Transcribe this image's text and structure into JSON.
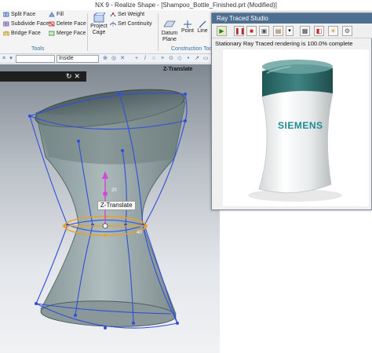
{
  "window": {
    "title": "NX 9 - Realize Shape - [Shampoo_Bottle_Finished.prt (Modified)]"
  },
  "ribbon": {
    "tools_group": {
      "items": [
        {
          "label": "Split Face",
          "icon": "split-face-icon"
        },
        {
          "label": "Fill",
          "icon": "fill-icon"
        },
        {
          "label": "Subdivide Face",
          "icon": "subdivide-face-icon"
        },
        {
          "label": "Delete Face",
          "icon": "delete-face-icon"
        },
        {
          "label": "Bridge Face",
          "icon": "bridge-face-icon"
        },
        {
          "label": "Merge Face",
          "icon": "merge-face-icon"
        }
      ],
      "label": "Tools"
    },
    "project_cage": {
      "label": "Project Cage",
      "icon": "project-cage-icon"
    },
    "set_weight": {
      "label": "Set Weight",
      "icon": "set-weight-icon"
    },
    "set_continuity": {
      "label": "Set Continuity",
      "icon": "set-continuity-icon"
    },
    "construction": {
      "label": "Construction Too",
      "datum_plane": "Datum Plane",
      "point": "Point",
      "line": "Line"
    }
  },
  "selection_bar": {
    "scope_value": "Inside"
  },
  "graphics": {
    "header": "Z-Translate",
    "handle_label": "Z-Translate",
    "handle_tick_top": "20",
    "handle_tick_right": "40"
  },
  "ray_traced_studio": {
    "title": "Ray Traced Studio",
    "status": "Stationary Ray Traced rendering is 100.0% complete",
    "label_brand": "SIEMENS"
  },
  "colors": {
    "titlebar_bg": "#ffffff",
    "ribbon_bg": "#f4f4f4",
    "group_label": "#2b6fa8",
    "cage_blue": "#2f4fd8",
    "rts_title_bg": "#4d6f91",
    "bottle_teal": "#2e6b6a",
    "siemens_teal": "#1f8a8f"
  }
}
